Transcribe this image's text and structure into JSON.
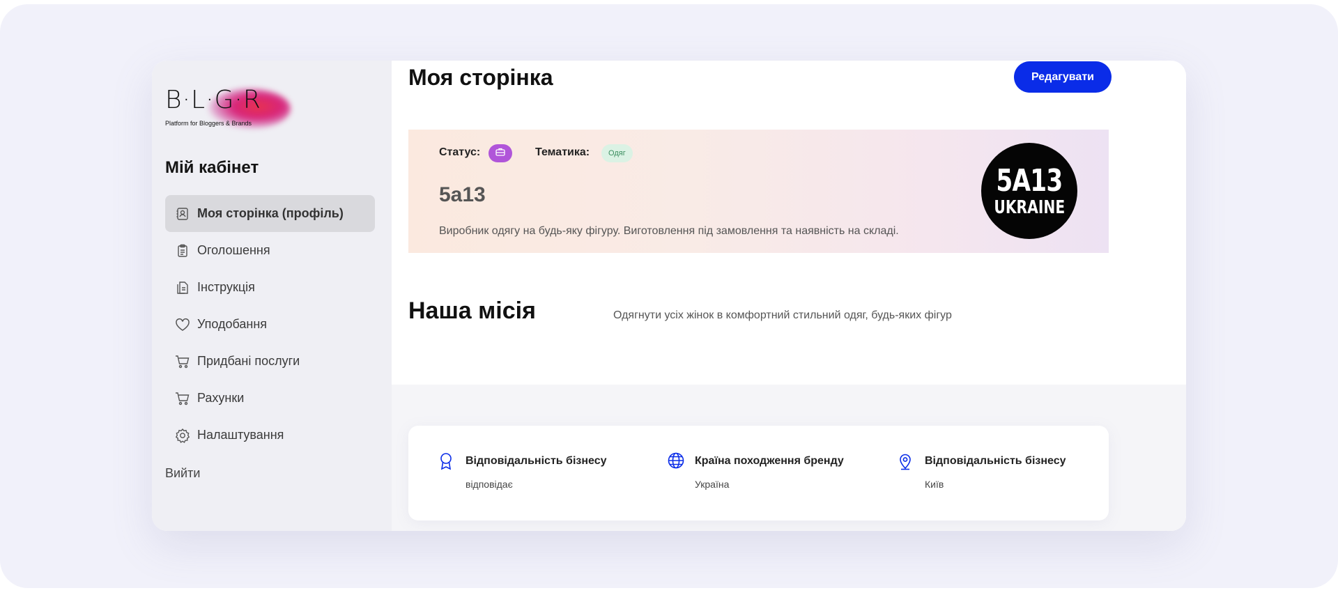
{
  "logo": {
    "text": "B·L·G·R",
    "subtitle": "Platform for Bloggers & Brands"
  },
  "sidebar": {
    "title": "Мій кабінет",
    "items": [
      {
        "label": "Моя сторінка (профіль)",
        "icon": "profile-card-icon",
        "active": true
      },
      {
        "label": "Оголошення",
        "icon": "clipboard-icon",
        "active": false
      },
      {
        "label": "Інструкція",
        "icon": "document-icon",
        "active": false
      },
      {
        "label": "Уподобання",
        "icon": "heart-icon",
        "active": false
      },
      {
        "label": "Придбані послуги",
        "icon": "cart-icon",
        "active": false
      },
      {
        "label": "Рахунки",
        "icon": "cart-icon",
        "active": false
      },
      {
        "label": "Налаштування",
        "icon": "gear-icon",
        "active": false
      }
    ],
    "logout": "Вийти"
  },
  "header": {
    "title": "Моя сторінка",
    "edit_label": "Редагувати"
  },
  "brand": {
    "status_label": "Статус:",
    "status_icon": "briefcase-icon",
    "topic_label": "Тематика:",
    "topic_value": "Одяг",
    "name": "5а13",
    "description": "Виробник одягу на будь-яку фігуру. Виготовлення під замовлення та наявність на складі.",
    "logo_line1": "5A13",
    "logo_line2": "UKRAINE"
  },
  "mission": {
    "title": "Наша місія",
    "text": "Одягнути усіх жінок в комфортний стильний одяг, будь-яких фігур"
  },
  "info": [
    {
      "title": "Відповідальність бізнесу",
      "value": "відповідає",
      "icon": "award-icon"
    },
    {
      "title": "Країна походження бренду",
      "value": "Україна",
      "icon": "globe-icon"
    },
    {
      "title": "Відповідальність бізнесу",
      "value": "Київ",
      "icon": "location-pin-icon"
    }
  ],
  "colors": {
    "accent": "#0a2ce8",
    "status_badge": "#b055d9",
    "topic_badge_bg": "#dbf2e4",
    "topic_badge_text": "#3b8e5f"
  }
}
